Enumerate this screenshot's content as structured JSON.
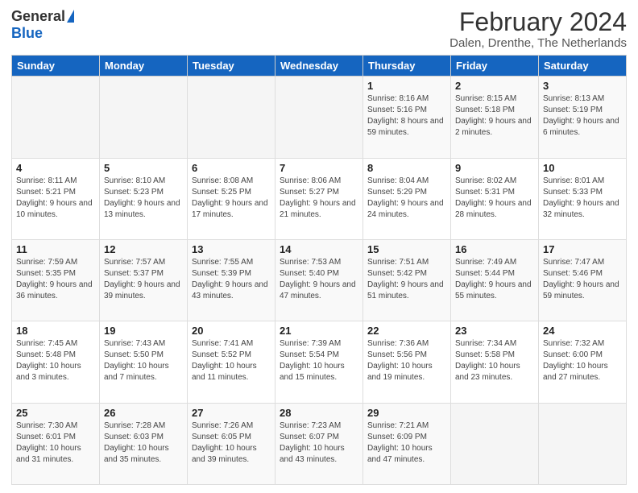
{
  "logo": {
    "general": "General",
    "blue": "Blue"
  },
  "header": {
    "month": "February 2024",
    "location": "Dalen, Drenthe, The Netherlands"
  },
  "days_of_week": [
    "Sunday",
    "Monday",
    "Tuesday",
    "Wednesday",
    "Thursday",
    "Friday",
    "Saturday"
  ],
  "weeks": [
    [
      {
        "day": "",
        "info": ""
      },
      {
        "day": "",
        "info": ""
      },
      {
        "day": "",
        "info": ""
      },
      {
        "day": "",
        "info": ""
      },
      {
        "day": "1",
        "info": "Sunrise: 8:16 AM\nSunset: 5:16 PM\nDaylight: 8 hours and 59 minutes."
      },
      {
        "day": "2",
        "info": "Sunrise: 8:15 AM\nSunset: 5:18 PM\nDaylight: 9 hours and 2 minutes."
      },
      {
        "day": "3",
        "info": "Sunrise: 8:13 AM\nSunset: 5:19 PM\nDaylight: 9 hours and 6 minutes."
      }
    ],
    [
      {
        "day": "4",
        "info": "Sunrise: 8:11 AM\nSunset: 5:21 PM\nDaylight: 9 hours and 10 minutes."
      },
      {
        "day": "5",
        "info": "Sunrise: 8:10 AM\nSunset: 5:23 PM\nDaylight: 9 hours and 13 minutes."
      },
      {
        "day": "6",
        "info": "Sunrise: 8:08 AM\nSunset: 5:25 PM\nDaylight: 9 hours and 17 minutes."
      },
      {
        "day": "7",
        "info": "Sunrise: 8:06 AM\nSunset: 5:27 PM\nDaylight: 9 hours and 21 minutes."
      },
      {
        "day": "8",
        "info": "Sunrise: 8:04 AM\nSunset: 5:29 PM\nDaylight: 9 hours and 24 minutes."
      },
      {
        "day": "9",
        "info": "Sunrise: 8:02 AM\nSunset: 5:31 PM\nDaylight: 9 hours and 28 minutes."
      },
      {
        "day": "10",
        "info": "Sunrise: 8:01 AM\nSunset: 5:33 PM\nDaylight: 9 hours and 32 minutes."
      }
    ],
    [
      {
        "day": "11",
        "info": "Sunrise: 7:59 AM\nSunset: 5:35 PM\nDaylight: 9 hours and 36 minutes."
      },
      {
        "day": "12",
        "info": "Sunrise: 7:57 AM\nSunset: 5:37 PM\nDaylight: 9 hours and 39 minutes."
      },
      {
        "day": "13",
        "info": "Sunrise: 7:55 AM\nSunset: 5:39 PM\nDaylight: 9 hours and 43 minutes."
      },
      {
        "day": "14",
        "info": "Sunrise: 7:53 AM\nSunset: 5:40 PM\nDaylight: 9 hours and 47 minutes."
      },
      {
        "day": "15",
        "info": "Sunrise: 7:51 AM\nSunset: 5:42 PM\nDaylight: 9 hours and 51 minutes."
      },
      {
        "day": "16",
        "info": "Sunrise: 7:49 AM\nSunset: 5:44 PM\nDaylight: 9 hours and 55 minutes."
      },
      {
        "day": "17",
        "info": "Sunrise: 7:47 AM\nSunset: 5:46 PM\nDaylight: 9 hours and 59 minutes."
      }
    ],
    [
      {
        "day": "18",
        "info": "Sunrise: 7:45 AM\nSunset: 5:48 PM\nDaylight: 10 hours and 3 minutes."
      },
      {
        "day": "19",
        "info": "Sunrise: 7:43 AM\nSunset: 5:50 PM\nDaylight: 10 hours and 7 minutes."
      },
      {
        "day": "20",
        "info": "Sunrise: 7:41 AM\nSunset: 5:52 PM\nDaylight: 10 hours and 11 minutes."
      },
      {
        "day": "21",
        "info": "Sunrise: 7:39 AM\nSunset: 5:54 PM\nDaylight: 10 hours and 15 minutes."
      },
      {
        "day": "22",
        "info": "Sunrise: 7:36 AM\nSunset: 5:56 PM\nDaylight: 10 hours and 19 minutes."
      },
      {
        "day": "23",
        "info": "Sunrise: 7:34 AM\nSunset: 5:58 PM\nDaylight: 10 hours and 23 minutes."
      },
      {
        "day": "24",
        "info": "Sunrise: 7:32 AM\nSunset: 6:00 PM\nDaylight: 10 hours and 27 minutes."
      }
    ],
    [
      {
        "day": "25",
        "info": "Sunrise: 7:30 AM\nSunset: 6:01 PM\nDaylight: 10 hours and 31 minutes."
      },
      {
        "day": "26",
        "info": "Sunrise: 7:28 AM\nSunset: 6:03 PM\nDaylight: 10 hours and 35 minutes."
      },
      {
        "day": "27",
        "info": "Sunrise: 7:26 AM\nSunset: 6:05 PM\nDaylight: 10 hours and 39 minutes."
      },
      {
        "day": "28",
        "info": "Sunrise: 7:23 AM\nSunset: 6:07 PM\nDaylight: 10 hours and 43 minutes."
      },
      {
        "day": "29",
        "info": "Sunrise: 7:21 AM\nSunset: 6:09 PM\nDaylight: 10 hours and 47 minutes."
      },
      {
        "day": "",
        "info": ""
      },
      {
        "day": "",
        "info": ""
      }
    ]
  ]
}
